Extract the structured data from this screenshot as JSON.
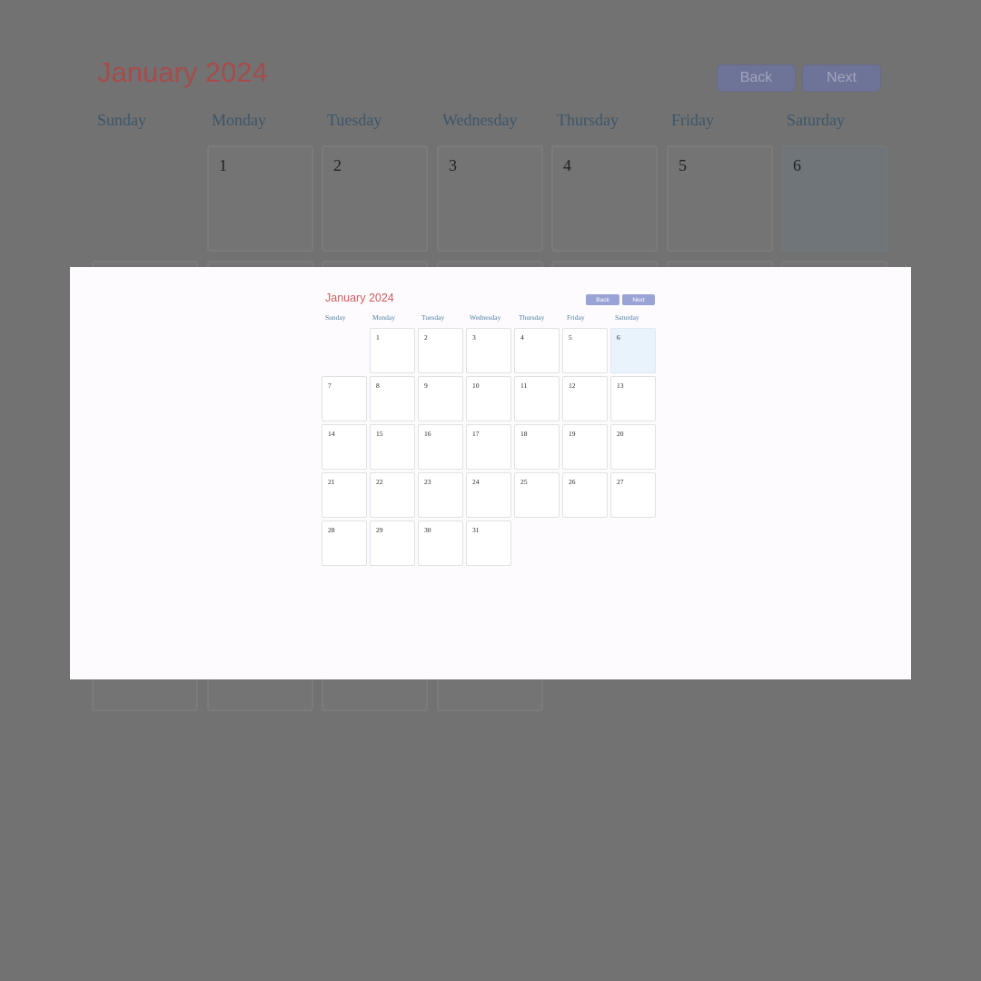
{
  "calendar": {
    "month_title": "January 2024",
    "back_label": "Back",
    "next_label": "Next",
    "weekdays": [
      "Sunday",
      "Monday",
      "Tuesday",
      "Wednesday",
      "Thursday",
      "Friday",
      "Saturday"
    ],
    "first_weekday_index": 1,
    "days_in_month": 31,
    "highlighted_day": 6
  },
  "colors": {
    "title": "#cd5e5e",
    "button": "#9aa3d6",
    "weekday_label": "#4c7ea0",
    "highlight": "#e8f3fb",
    "backdrop": "#727272"
  }
}
